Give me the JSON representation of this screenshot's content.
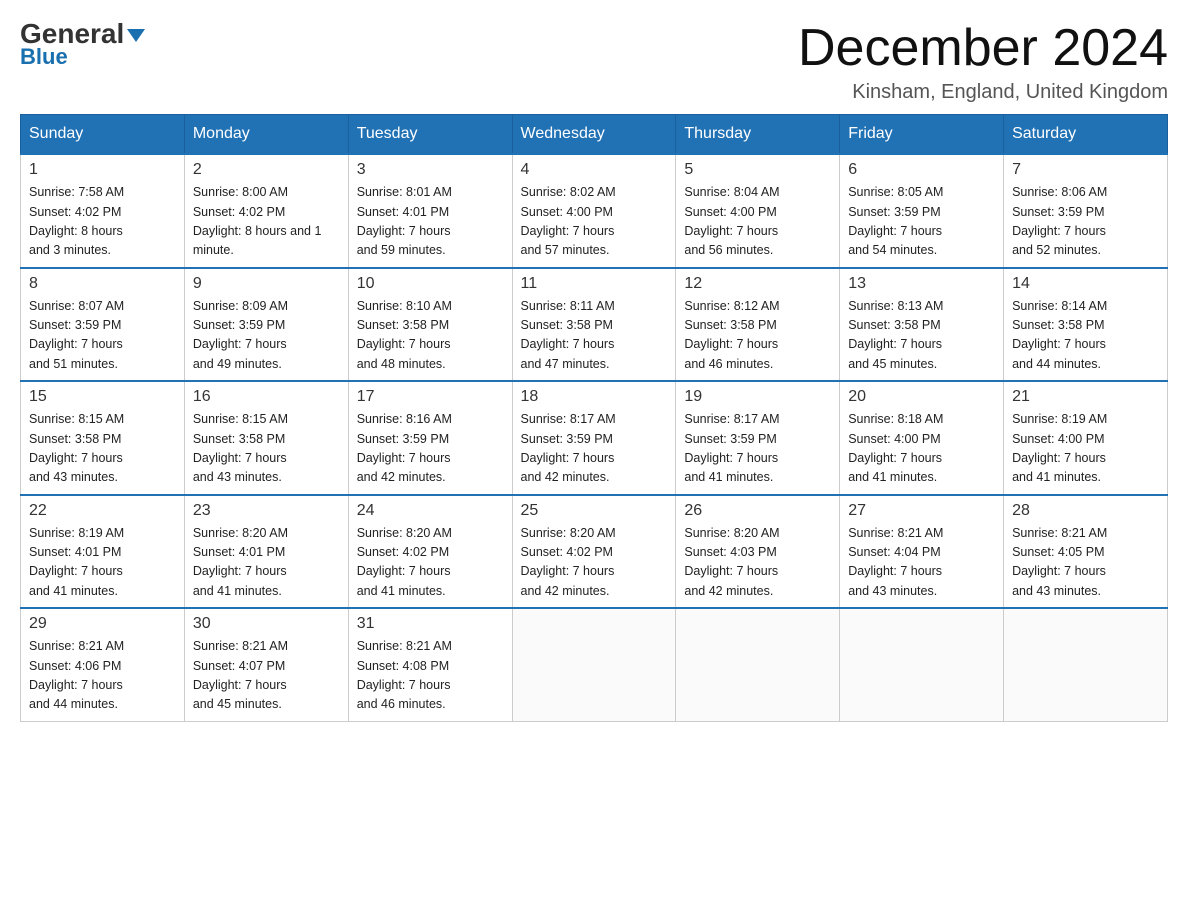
{
  "logo": {
    "text_general": "General",
    "text_blue": "Blue"
  },
  "header": {
    "month_title": "December 2024",
    "location": "Kinsham, England, United Kingdom"
  },
  "days_of_week": [
    "Sunday",
    "Monday",
    "Tuesday",
    "Wednesday",
    "Thursday",
    "Friday",
    "Saturday"
  ],
  "weeks": [
    [
      {
        "day": "1",
        "sunrise": "7:58 AM",
        "sunset": "4:02 PM",
        "daylight": "8 hours and 3 minutes."
      },
      {
        "day": "2",
        "sunrise": "8:00 AM",
        "sunset": "4:02 PM",
        "daylight": "8 hours and 1 minute."
      },
      {
        "day": "3",
        "sunrise": "8:01 AM",
        "sunset": "4:01 PM",
        "daylight": "7 hours and 59 minutes."
      },
      {
        "day": "4",
        "sunrise": "8:02 AM",
        "sunset": "4:00 PM",
        "daylight": "7 hours and 57 minutes."
      },
      {
        "day": "5",
        "sunrise": "8:04 AM",
        "sunset": "4:00 PM",
        "daylight": "7 hours and 56 minutes."
      },
      {
        "day": "6",
        "sunrise": "8:05 AM",
        "sunset": "3:59 PM",
        "daylight": "7 hours and 54 minutes."
      },
      {
        "day": "7",
        "sunrise": "8:06 AM",
        "sunset": "3:59 PM",
        "daylight": "7 hours and 52 minutes."
      }
    ],
    [
      {
        "day": "8",
        "sunrise": "8:07 AM",
        "sunset": "3:59 PM",
        "daylight": "7 hours and 51 minutes."
      },
      {
        "day": "9",
        "sunrise": "8:09 AM",
        "sunset": "3:59 PM",
        "daylight": "7 hours and 49 minutes."
      },
      {
        "day": "10",
        "sunrise": "8:10 AM",
        "sunset": "3:58 PM",
        "daylight": "7 hours and 48 minutes."
      },
      {
        "day": "11",
        "sunrise": "8:11 AM",
        "sunset": "3:58 PM",
        "daylight": "7 hours and 47 minutes."
      },
      {
        "day": "12",
        "sunrise": "8:12 AM",
        "sunset": "3:58 PM",
        "daylight": "7 hours and 46 minutes."
      },
      {
        "day": "13",
        "sunrise": "8:13 AM",
        "sunset": "3:58 PM",
        "daylight": "7 hours and 45 minutes."
      },
      {
        "day": "14",
        "sunrise": "8:14 AM",
        "sunset": "3:58 PM",
        "daylight": "7 hours and 44 minutes."
      }
    ],
    [
      {
        "day": "15",
        "sunrise": "8:15 AM",
        "sunset": "3:58 PM",
        "daylight": "7 hours and 43 minutes."
      },
      {
        "day": "16",
        "sunrise": "8:15 AM",
        "sunset": "3:58 PM",
        "daylight": "7 hours and 43 minutes."
      },
      {
        "day": "17",
        "sunrise": "8:16 AM",
        "sunset": "3:59 PM",
        "daylight": "7 hours and 42 minutes."
      },
      {
        "day": "18",
        "sunrise": "8:17 AM",
        "sunset": "3:59 PM",
        "daylight": "7 hours and 42 minutes."
      },
      {
        "day": "19",
        "sunrise": "8:17 AM",
        "sunset": "3:59 PM",
        "daylight": "7 hours and 41 minutes."
      },
      {
        "day": "20",
        "sunrise": "8:18 AM",
        "sunset": "4:00 PM",
        "daylight": "7 hours and 41 minutes."
      },
      {
        "day": "21",
        "sunrise": "8:19 AM",
        "sunset": "4:00 PM",
        "daylight": "7 hours and 41 minutes."
      }
    ],
    [
      {
        "day": "22",
        "sunrise": "8:19 AM",
        "sunset": "4:01 PM",
        "daylight": "7 hours and 41 minutes."
      },
      {
        "day": "23",
        "sunrise": "8:20 AM",
        "sunset": "4:01 PM",
        "daylight": "7 hours and 41 minutes."
      },
      {
        "day": "24",
        "sunrise": "8:20 AM",
        "sunset": "4:02 PM",
        "daylight": "7 hours and 41 minutes."
      },
      {
        "day": "25",
        "sunrise": "8:20 AM",
        "sunset": "4:02 PM",
        "daylight": "7 hours and 42 minutes."
      },
      {
        "day": "26",
        "sunrise": "8:20 AM",
        "sunset": "4:03 PM",
        "daylight": "7 hours and 42 minutes."
      },
      {
        "day": "27",
        "sunrise": "8:21 AM",
        "sunset": "4:04 PM",
        "daylight": "7 hours and 43 minutes."
      },
      {
        "day": "28",
        "sunrise": "8:21 AM",
        "sunset": "4:05 PM",
        "daylight": "7 hours and 43 minutes."
      }
    ],
    [
      {
        "day": "29",
        "sunrise": "8:21 AM",
        "sunset": "4:06 PM",
        "daylight": "7 hours and 44 minutes."
      },
      {
        "day": "30",
        "sunrise": "8:21 AM",
        "sunset": "4:07 PM",
        "daylight": "7 hours and 45 minutes."
      },
      {
        "day": "31",
        "sunrise": "8:21 AM",
        "sunset": "4:08 PM",
        "daylight": "7 hours and 46 minutes."
      },
      null,
      null,
      null,
      null
    ]
  ],
  "labels": {
    "sunrise": "Sunrise:",
    "sunset": "Sunset:",
    "daylight": "Daylight:"
  }
}
